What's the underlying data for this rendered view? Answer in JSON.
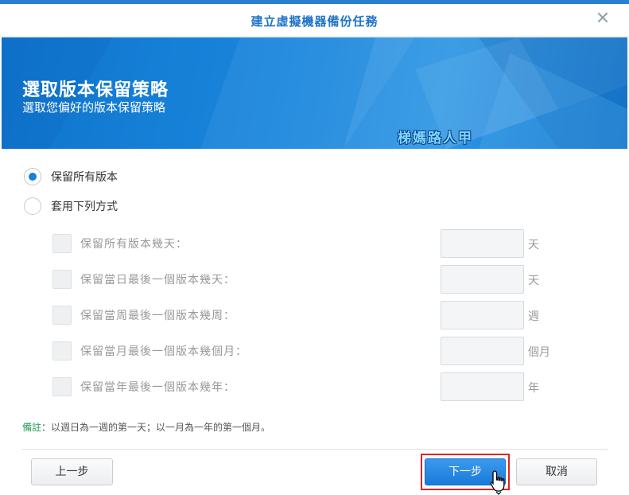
{
  "dialog": {
    "title": "建立虛擬機器備份任務"
  },
  "banner": {
    "heading": "選取版本保留策略",
    "subheading": "選取您偏好的版本保留策略",
    "watermark": "梯媽路人甲"
  },
  "retention": {
    "options": [
      {
        "label": "保留所有版本",
        "selected": true
      },
      {
        "label": "套用下列方式",
        "selected": false
      }
    ],
    "rules": [
      {
        "label": "保留所有版本幾天：",
        "value": "",
        "unit": "天"
      },
      {
        "label": "保留當日最後一個版本幾天：",
        "value": "",
        "unit": "天"
      },
      {
        "label": "保留當周最後一個版本幾周：",
        "value": "",
        "unit": "週"
      },
      {
        "label": "保留當月最後一個版本幾個月：",
        "value": "",
        "unit": "個月"
      },
      {
        "label": "保留當年最後一個版本幾年：",
        "value": "",
        "unit": "年"
      }
    ]
  },
  "note": {
    "key": "備註",
    "text": "：以週日為一週的第一天；以一月為一年的第一個月。"
  },
  "footer": {
    "back_label": "上一步",
    "next_label": "下一步",
    "cancel_label": "取消"
  },
  "colors": {
    "accent": "#1a7ed6",
    "banner": "#1a86dd",
    "highlight": "#e02424"
  }
}
